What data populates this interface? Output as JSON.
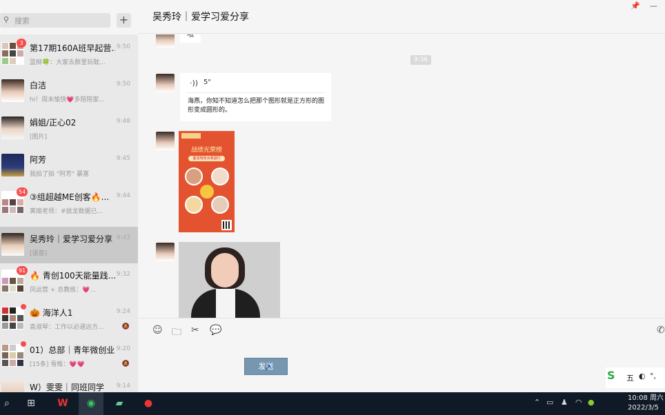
{
  "sidebar": {
    "search_placeholder": "搜索",
    "add_label": "+",
    "chats": [
      {
        "name": "第17期160A班早起营...",
        "time": "9:50",
        "preview": "蓝柳🍀：大家去群里玩耽...",
        "badge": "3"
      },
      {
        "name": "白洁",
        "time": "9:50",
        "preview": "hi！周末愉快💗多陪陪家..."
      },
      {
        "name": "娟姐/正心02",
        "time": "9:48",
        "preview": "[图片]"
      },
      {
        "name": "阿芳",
        "time": "9:45",
        "preview": "我拍了拍 \"阿芳\" 暴富"
      },
      {
        "name": "③组超越ME创客🔥...",
        "time": "9:44",
        "preview": "黄瑜老师：#拢龙数据已...",
        "badge": "54"
      },
      {
        "name": "吴秀玲｜爱学习爱分享",
        "time": "9:43",
        "preview": "[语音]"
      },
      {
        "name": "🔥 青创100天能量践...",
        "time": "9:32",
        "preview": "凤运营 + 总教练：💗...",
        "badge": "91"
      },
      {
        "name": "🎃 海洋人1",
        "time": "9:24",
        "preview": "袁淑琴：工作以必通远方..."
      },
      {
        "name": "01）总部｜青年微创业",
        "time": "9:20",
        "preview": "[15条] 雪瓶：💗💗"
      },
      {
        "name": "W）雯雯｜同班同学",
        "time": "9:14",
        "preview": ""
      }
    ]
  },
  "header": {
    "title": "吴秀玲｜爱学习爱分享",
    "pin_icon": "pin-icon",
    "minimize_icon": "minimize-icon"
  },
  "messages": {
    "top_text": "哦",
    "timestamp": "9:36",
    "voice_duration": "5\"",
    "voice_transcript": "海燕，你知不知道怎么把那个图形就是正方形的图形变成圆形的。",
    "poster_title": "战绩光荣榜",
    "poster_subtitle": "金龙鸡年大奖进行"
  },
  "toolbar": {
    "emoji": "emoji-icon",
    "folder": "folder-icon",
    "scissors": "scissors-icon",
    "chat": "chat-bubble-icon"
  },
  "input": {
    "send_label": "发送"
  },
  "ime": {
    "label": "五"
  },
  "taskbar": {
    "time": "10:08 周六",
    "date": "2022/3/5"
  },
  "colors": {
    "sidebar_bg": "#e9e9e9",
    "active_chat": "#c9c9c9",
    "badge": "#f74c4c",
    "send_button": "#7796b0",
    "taskbar": "#101a26",
    "poster_bg": "#e4532f"
  }
}
